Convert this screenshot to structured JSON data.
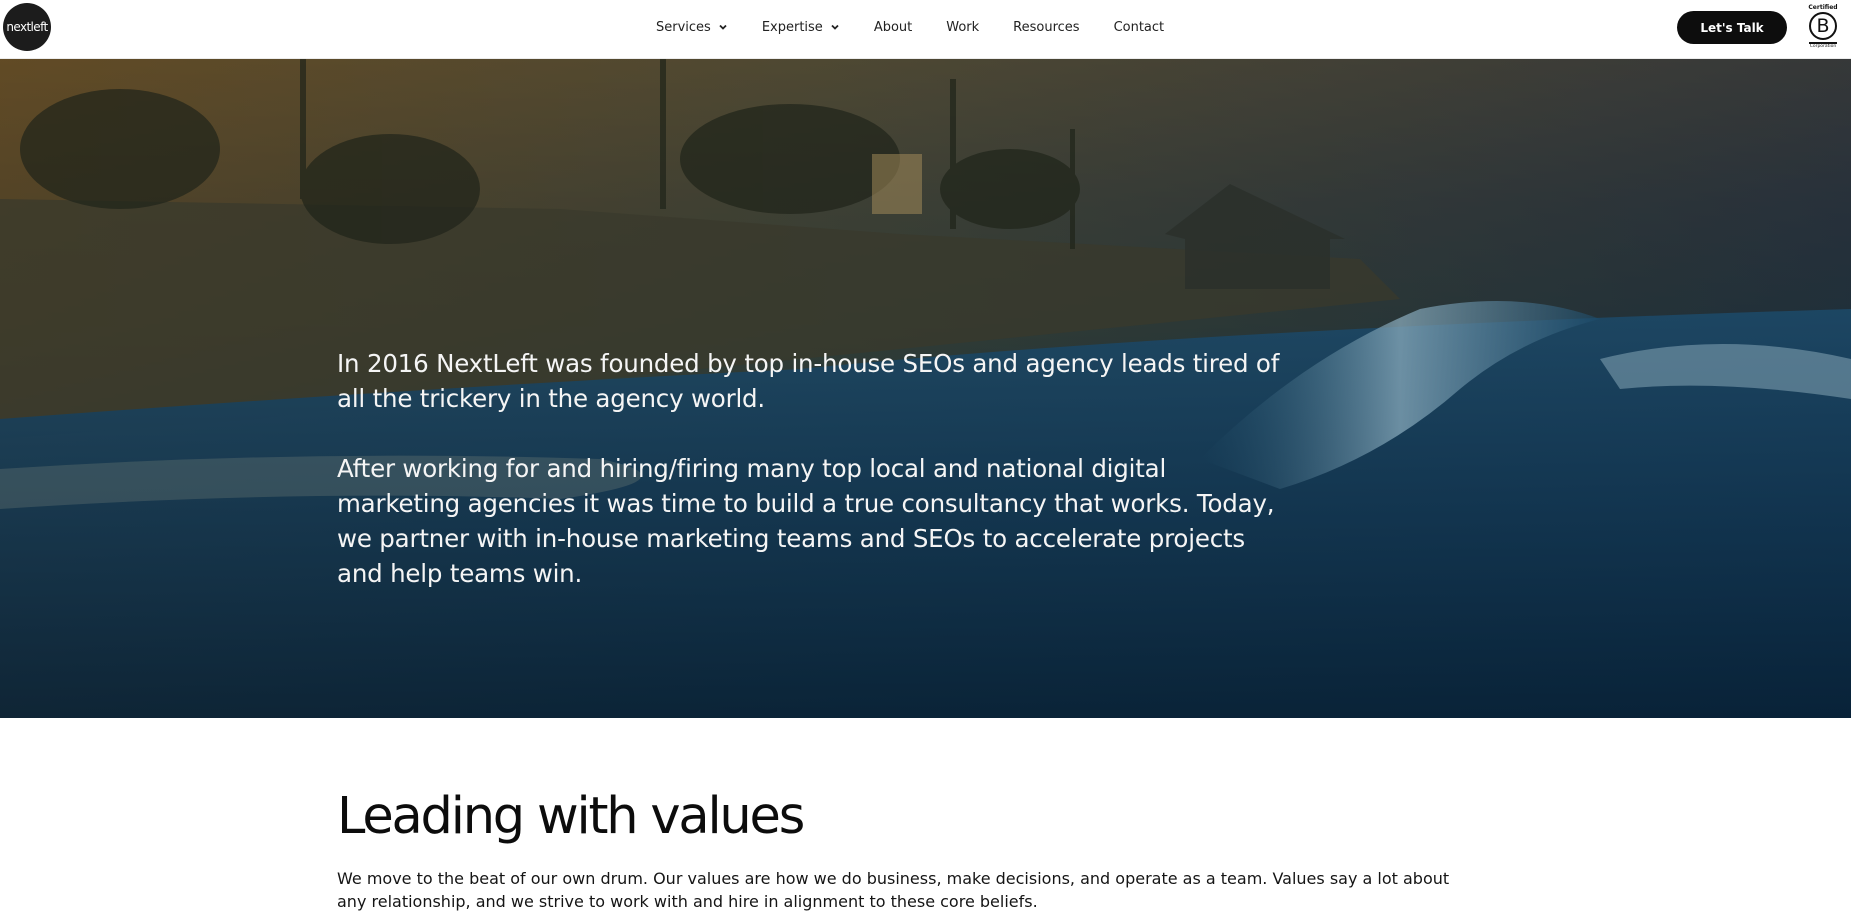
{
  "header": {
    "logo_text": "nextleft",
    "nav": [
      {
        "label": "Services",
        "has_dropdown": true
      },
      {
        "label": "Expertise",
        "has_dropdown": true
      },
      {
        "label": "About",
        "has_dropdown": false
      },
      {
        "label": "Work",
        "has_dropdown": false
      },
      {
        "label": "Resources",
        "has_dropdown": false
      },
      {
        "label": "Contact",
        "has_dropdown": false
      }
    ],
    "cta_label": "Let's Talk",
    "badge": {
      "top": "Certified",
      "mark": "B",
      "bottom": "Corporation"
    }
  },
  "hero": {
    "paragraph1": "In 2016 NextLeft was founded by top in-house SEOs and agency leads tired of all the trickery in the agency world.",
    "paragraph2": "After working for and hiring/firing many top local and national digital marketing agencies it was time to build a true consultancy that works. Today, we partner with in-house marketing teams and SEOs to accelerate projects and help teams win."
  },
  "values": {
    "title": "Leading with values",
    "body": "We move to the beat of our own drum. Our values are how we do business, make decisions, and operate as a team. Values say a lot about any relationship, and we strive to work with and hire in alignment to these core beliefs."
  },
  "colors": {
    "cta_background": "#0d0d0d",
    "hero_text": "#f5f5f5",
    "ocean": "#0c2a45"
  }
}
